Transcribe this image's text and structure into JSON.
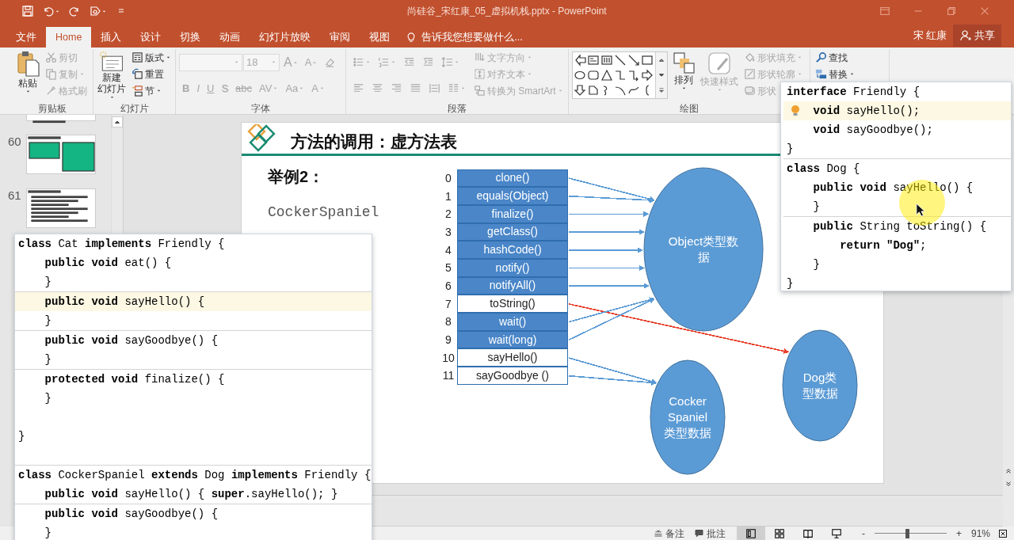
{
  "window": {
    "title": "尚硅谷_宋红康_05_虚拟机栈.pptx - PowerPoint"
  },
  "tabs": [
    {
      "label": "文件",
      "selected": false
    },
    {
      "label": "Home",
      "selected": true
    },
    {
      "label": "插入",
      "selected": false
    },
    {
      "label": "设计",
      "selected": false
    },
    {
      "label": "切换",
      "selected": false
    },
    {
      "label": "动画",
      "selected": false
    },
    {
      "label": "幻灯片放映",
      "selected": false
    },
    {
      "label": "审阅",
      "selected": false
    },
    {
      "label": "视图",
      "selected": false
    }
  ],
  "tell_me": {
    "placeholder": "告诉我您想要做什么..."
  },
  "user": "宋 红康",
  "share": "共享",
  "ribbon": {
    "groups": [
      {
        "label": "剪贴板",
        "columns": [
          {
            "kind": "large",
            "label": "粘贴",
            "disabled": false,
            "caret": true
          },
          {
            "kind": "stack",
            "items": [
              {
                "label": "剪切",
                "disabled": true,
                "caret": false
              },
              {
                "label": "复制",
                "disabled": true,
                "caret": true
              },
              {
                "label": "格式刷",
                "disabled": true,
                "caret": false
              }
            ]
          }
        ]
      },
      {
        "label": "幻灯片",
        "columns": [
          {
            "kind": "large",
            "label": "新建幻灯片",
            "disabled": false,
            "caret": true
          },
          {
            "kind": "stack",
            "items": [
              {
                "label": "版式",
                "disabled": false,
                "caret": true
              },
              {
                "label": "重置",
                "disabled": false,
                "caret": false
              },
              {
                "label": "节",
                "disabled": false,
                "caret": true
              }
            ]
          }
        ]
      },
      {
        "label": "字体",
        "columns": [
          {
            "kind": "rows",
            "rows": [
              {
                "items": [
                  {
                    "kind": "field",
                    "disabled": true,
                    "caret": true
                  },
                  {
                    "kind": "field",
                    "value": "18",
                    "disabled": true,
                    "caret": true
                  },
                  {
                    "kind": "grow",
                    "label": "A",
                    "disabled": true,
                    "caret": false
                  },
                  {
                    "kind": "shrink",
                    "label": "A",
                    "disabled": true,
                    "caret": false
                  },
                  {
                    "kind": "icon",
                    "disabled": true,
                    "caret": false
                  }
                ]
              },
              {
                "items": [
                  {
                    "kind": "glyph",
                    "label": "B",
                    "disabled": true,
                    "caret": false
                  },
                  {
                    "kind": "glyph",
                    "label": "I",
                    "disabled": true,
                    "caret": false
                  },
                  {
                    "kind": "glyph",
                    "label": "U",
                    "disabled": true,
                    "caret": false
                  },
                  {
                    "kind": "glyph",
                    "label": "S",
                    "disabled": true,
                    "caret": false
                  },
                  {
                    "kind": "glyph",
                    "label": "abc",
                    "disabled": true,
                    "caret": false
                  },
                  {
                    "kind": "glyph",
                    "label": "AV",
                    "disabled": true,
                    "caret": true
                  },
                  {
                    "kind": "glyph",
                    "label": "Aa",
                    "disabled": true,
                    "caret": true
                  },
                  {
                    "kind": "glyph",
                    "label": "A",
                    "disabled": true,
                    "caret": true
                  }
                ]
              }
            ]
          }
        ]
      },
      {
        "label": "段落",
        "columns": [
          {
            "kind": "rows",
            "rows": [
              {
                "items": [
                  {
                    "kind": "icon",
                    "disabled": true,
                    "caret": true
                  },
                  {
                    "kind": "icon",
                    "disabled": true,
                    "caret": true
                  },
                  {
                    "kind": "icon",
                    "disabled": true,
                    "caret": false
                  },
                  {
                    "kind": "icon",
                    "disabled": true,
                    "caret": false
                  },
                  {
                    "kind": "icon",
                    "disabled": true,
                    "caret": true
                  }
                ]
              },
              {
                "items": [
                  {
                    "kind": "icon",
                    "disabled": true,
                    "caret": false
                  },
                  {
                    "kind": "icon",
                    "disabled": true,
                    "caret": false
                  },
                  {
                    "kind": "icon",
                    "disabled": true,
                    "caret": false
                  },
                  {
                    "kind": "icon",
                    "disabled": true,
                    "caret": false
                  },
                  {
                    "kind": "icon",
                    "disabled": true,
                    "caret": false
                  },
                  {
                    "kind": "icon",
                    "disabled": true,
                    "caret": true
                  }
                ]
              }
            ]
          },
          {
            "kind": "stack",
            "items": [
              {
                "label": "文字方向",
                "disabled": true,
                "caret": true
              },
              {
                "label": "对齐文本",
                "disabled": true,
                "caret": true
              },
              {
                "label": "转换为 SmartArt",
                "disabled": true,
                "caret": true
              }
            ]
          }
        ]
      },
      {
        "label": "绘图",
        "columns": [
          {
            "kind": "gallery"
          },
          {
            "kind": "large",
            "label": "排列",
            "disabled": false,
            "caret": true
          },
          {
            "kind": "large",
            "label": "快速样式",
            "disabled": true,
            "caret": true
          },
          {
            "kind": "stack",
            "items": [
              {
                "label": "形状填充",
                "disabled": true,
                "caret": true
              },
              {
                "label": "形状轮廓",
                "disabled": true,
                "caret": true
              },
              {
                "label": "形状",
                "disabled": true,
                "caret": false
              }
            ]
          }
        ]
      },
      {
        "columns": [
          {
            "kind": "stack",
            "items": [
              {
                "label": "查找",
                "disabled": false,
                "caret": false
              },
              {
                "label": "替换",
                "disabled": false,
                "caret": true
              }
            ]
          }
        ]
      }
    ]
  },
  "thumbnails": [
    {
      "kind": "cut"
    },
    {
      "kind": "boxes",
      "number": "60"
    },
    {
      "kind": "text",
      "number": "61"
    }
  ],
  "slide": {
    "title": "方法的调用：虚方法表",
    "example": "举例2：",
    "class_name": "CockerSpaniel",
    "table": [
      {
        "index": "0",
        "method": "clone()",
        "filled": true,
        "color": "#5b9bd5"
      },
      {
        "index": "1",
        "method": "equals(Object)",
        "filled": true,
        "color": "#5b9bd5"
      },
      {
        "index": "2",
        "method": "finalize()",
        "filled": true,
        "color": "#5b9bd5"
      },
      {
        "index": "3",
        "method": "getClass()",
        "filled": true,
        "color": "#5b9bd5"
      },
      {
        "index": "4",
        "method": "hashCode()",
        "filled": true,
        "color": "#5b9bd5"
      },
      {
        "index": "5",
        "method": "notify()",
        "filled": true,
        "color": "#5b9bd5"
      },
      {
        "index": "6",
        "method": "notifyAll()",
        "filled": true,
        "color": "#5b9bd5"
      },
      {
        "index": "7",
        "method": "toString()",
        "filled": false,
        "color": "#e8412c"
      },
      {
        "index": "8",
        "method": "wait()",
        "filled": true,
        "color": "#5b9bd5"
      },
      {
        "index": "9",
        "method": "wait(long)",
        "filled": true,
        "color": "#5b9bd5"
      },
      {
        "index": "10",
        "method": "sayHello()",
        "filled": false,
        "color": "#5b9bd5"
      },
      {
        "index": "11",
        "method": "sayGoodbye ()",
        "filled": false,
        "color": "#5b9bd5"
      }
    ],
    "ellipses": [
      {
        "label": "Object类型数据"
      },
      {
        "label": "Cocker Spaniel类型数据"
      },
      {
        "label": "Dog类型数据"
      }
    ]
  },
  "popups": [
    {
      "bulb": false,
      "blocks": [
        {
          "kind": "head",
          "lines": [
            {
              "highlighted": false,
              "text": "**class** Cat **implements** Friendly {"
            },
            {
              "highlighted": false,
              "text": "    **public void** eat() {"
            },
            {
              "highlighted": false,
              "text": "    }"
            }
          ]
        },
        {
          "kind": "method",
          "lines": [
            {
              "highlighted": true,
              "text": "    **public void** sayHello() {"
            },
            {
              "highlighted": false,
              "text": "    }"
            }
          ]
        },
        {
          "kind": "method",
          "lines": [
            {
              "highlighted": false,
              "text": "    **public void** sayGoodbye() {"
            },
            {
              "highlighted": false,
              "text": "    }"
            }
          ]
        },
        {
          "kind": "method",
          "lines": [
            {
              "highlighted": false,
              "text": "    **protected void** finalize() {"
            },
            {
              "highlighted": false,
              "text": "    }"
            }
          ]
        },
        {
          "kind": "closing",
          "lines": [
            {
              "highlighted": false,
              "text": "}"
            }
          ]
        },
        {
          "kind": "method",
          "lines": [
            {
              "highlighted": false,
              "text": "**class** CockerSpaniel **extends** Dog **implements** Friendly {"
            },
            {
              "highlighted": false,
              "text": "    **public void** sayHello() { **super**.sayHello(); }"
            }
          ]
        },
        {
          "kind": "method",
          "lines": [
            {
              "highlighted": false,
              "text": "    **public void** sayGoodbye() {"
            },
            {
              "highlighted": false,
              "text": "    }"
            }
          ]
        }
      ]
    },
    {
      "bulb": true,
      "blocks": [
        {
          "kind": "head",
          "lines": [
            {
              "highlighted": false,
              "text": "**interface** Friendly {"
            },
            {
              "highlighted": true,
              "text": "    **void** sayHello();"
            },
            {
              "highlighted": false,
              "text": "    **void** sayGoodbye();"
            },
            {
              "highlighted": false,
              "text": "}"
            }
          ]
        },
        {
          "kind": "method",
          "lines": [
            {
              "highlighted": false,
              "text": "**class** Dog {"
            },
            {
              "highlighted": false,
              "text": "    **public void** sayHello() {"
            },
            {
              "highlighted": false,
              "text": "    }"
            }
          ]
        },
        {
          "kind": "method",
          "lines": [
            {
              "highlighted": false,
              "text": "    **public** String toString() {"
            },
            {
              "highlighted": false,
              "text": "        **return \"Dog\"**;"
            },
            {
              "highlighted": false,
              "text": "    }"
            },
            {
              "highlighted": false,
              "text": "}"
            }
          ]
        }
      ]
    }
  ],
  "status_bar": {
    "notes": "备注",
    "comments": "批注",
    "views": [
      {
        "selected": true
      },
      {
        "selected": false
      },
      {
        "selected": false
      },
      {
        "selected": false
      }
    ],
    "zoom_out": "-",
    "zoom_in": "+",
    "zoom": {
      "level": 0.45
    },
    "zoom_reading": "91%"
  }
}
